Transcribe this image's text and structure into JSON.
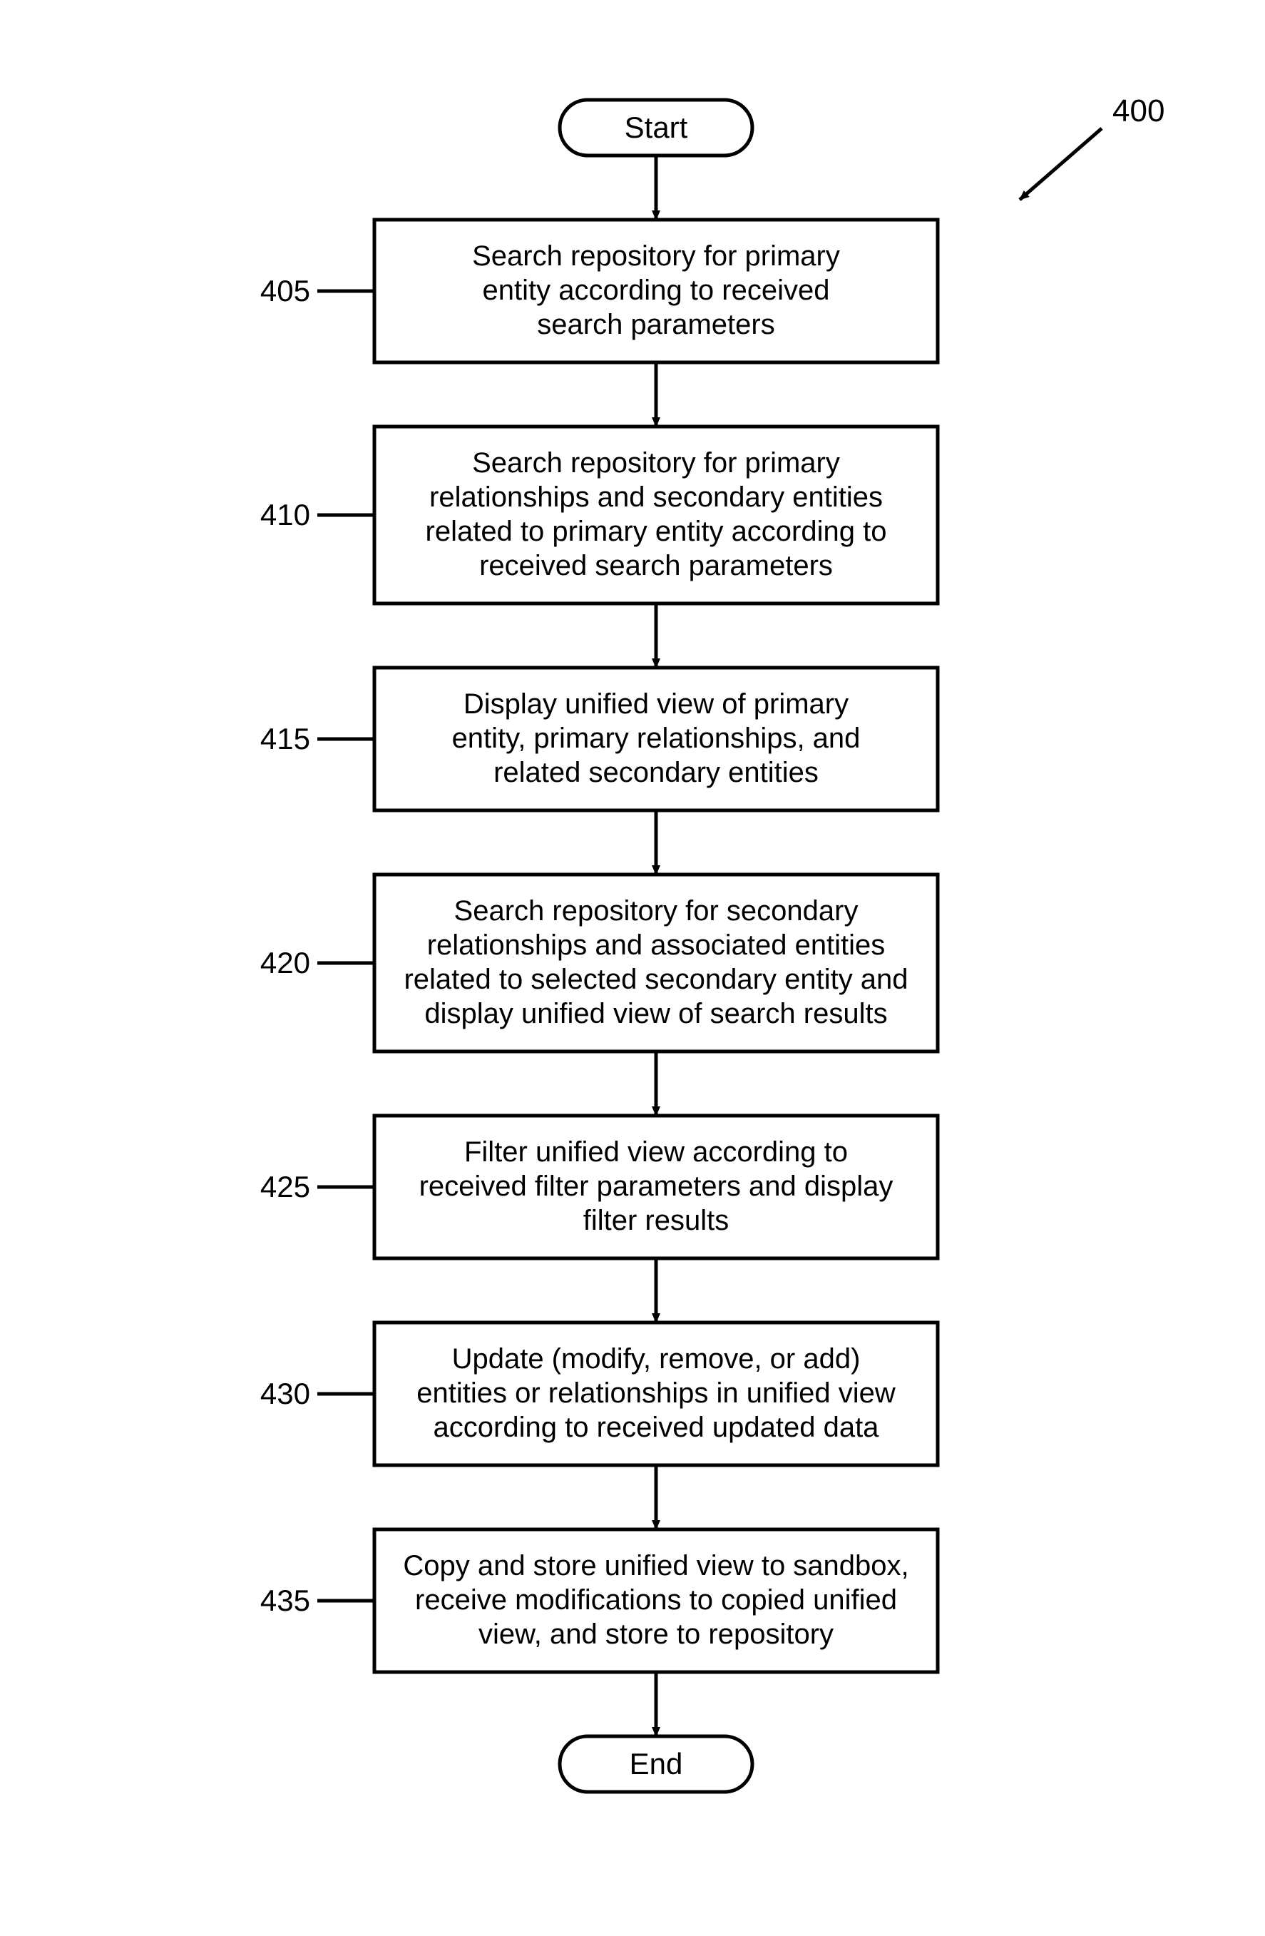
{
  "diagram": {
    "ref_number": "400",
    "start": "Start",
    "end": "End",
    "steps": [
      {
        "num": "405",
        "lines": [
          "Search repository for primary",
          "entity according to received",
          "search parameters"
        ]
      },
      {
        "num": "410",
        "lines": [
          "Search repository for primary",
          "relationships and secondary entities",
          "related to primary entity according to",
          "received search parameters"
        ]
      },
      {
        "num": "415",
        "lines": [
          "Display unified view of primary",
          "entity, primary relationships, and",
          "related secondary entities"
        ]
      },
      {
        "num": "420",
        "lines": [
          "Search repository for secondary",
          "relationships and associated entities",
          "related to selected secondary entity and",
          "display unified view of search results"
        ]
      },
      {
        "num": "425",
        "lines": [
          "Filter unified view according to",
          "received filter parameters and display",
          "filter results"
        ]
      },
      {
        "num": "430",
        "lines": [
          "Update (modify, remove, or add)",
          "entities or relationships in unified view",
          "according to received updated data"
        ]
      },
      {
        "num": "435",
        "lines": [
          "Copy and store unified view to sandbox,",
          "receive modifications to copied unified",
          "view, and store to repository"
        ]
      }
    ]
  }
}
